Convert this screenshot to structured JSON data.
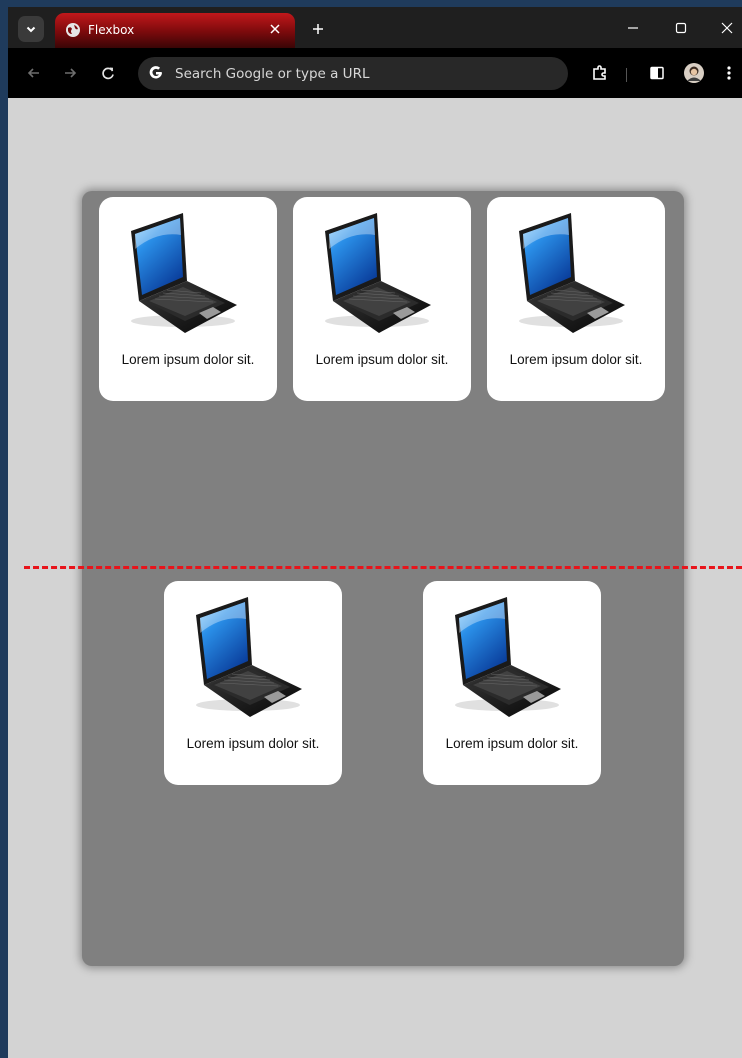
{
  "browser": {
    "tab_title": "Flexbox",
    "omnibox_placeholder": "Search Google or type a URL"
  },
  "cards": [
    {
      "caption": "Lorem ipsum dolor sit."
    },
    {
      "caption": "Lorem ipsum dolor sit."
    },
    {
      "caption": "Lorem ipsum dolor sit."
    },
    {
      "caption": "Lorem ipsum dolor sit."
    },
    {
      "caption": "Lorem ipsum dolor sit."
    }
  ],
  "icons": {
    "tab_search": "chevron-down-icon",
    "favicon": "globe-icon",
    "tab_close": "close-icon",
    "new_tab": "plus-icon",
    "minimize": "minimize-icon",
    "maximize": "maximize-icon",
    "close_window": "close-icon",
    "back": "arrow-left-icon",
    "forward": "arrow-right-icon",
    "reload": "reload-icon",
    "google": "google-g-icon",
    "extensions": "puzzle-icon",
    "side_panel": "side-panel-icon",
    "profile": "avatar-icon",
    "menu": "kebab-menu-icon",
    "card_image": "laptop-image"
  },
  "colors": {
    "tab_active": "#b31214",
    "page_background": "#d3d3d3",
    "container": "#808080",
    "card": "#ffffff",
    "divider": "#e8141b"
  }
}
